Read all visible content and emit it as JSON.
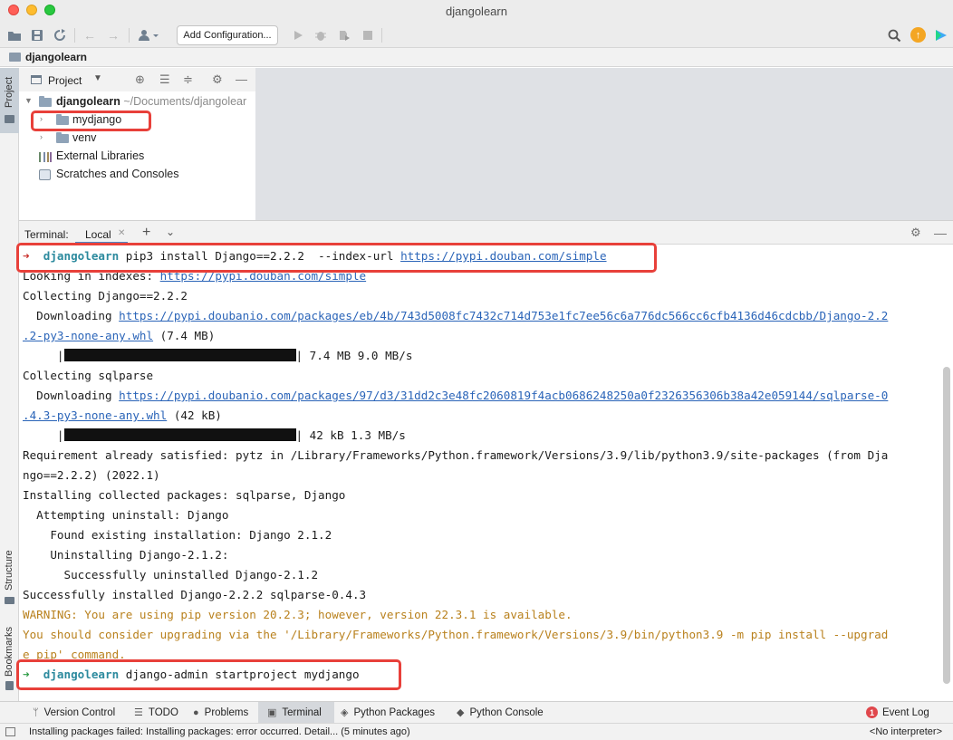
{
  "window": {
    "title": "djangolearn"
  },
  "toolbar": {
    "add_configuration": "Add Configuration...",
    "update_badge": "↑"
  },
  "navbar": {
    "project": "djangolearn"
  },
  "left_strip": {
    "project": "Project",
    "structure": "Structure",
    "bookmarks": "Bookmarks"
  },
  "project_panel": {
    "header": "Project",
    "root_name": "djangolearn",
    "root_path": "~/Documents/djangolear",
    "folders": [
      "mydjango",
      "venv"
    ],
    "external_libraries": "External Libraries",
    "scratches": "Scratches and Consoles"
  },
  "terminal": {
    "title": "Terminal:",
    "tab": "Local",
    "lines": {
      "l1_cmd": "pip3 install Django==2.2.2  --index-url ",
      "l1_url": "https://pypi.douban.com/simple",
      "l2_pre": "Looking in indexes: ",
      "l2_url": "https://pypi.douban.com/simple",
      "l3": "Collecting Django==2.2.2",
      "l4_pre": "  Downloading ",
      "l4_url": "https://pypi.doubanio.com/packages/eb/4b/743d5008fc7432c714d753e1fc7ee56c6a776dc566cc6cfb4136d46cdcbb/Django-2.2",
      "l5_url": ".2-py3-none-any.whl",
      "l5_post": " (7.4 MB)",
      "l6_pre": "     |",
      "l6_post": "| 7.4 MB 9.0 MB/s",
      "l7": "Collecting sqlparse",
      "l8_pre": "  Downloading ",
      "l8_url": "https://pypi.doubanio.com/packages/97/d3/31dd2c3e48fc2060819f4acb0686248250a0f2326356306b38a42e059144/sqlparse-0",
      "l9_url": ".4.3-py3-none-any.whl",
      "l9_post": " (42 kB)",
      "l10_pre": "     |",
      "l10_post": "| 42 kB 1.3 MB/s",
      "l11": "Requirement already satisfied: pytz in /Library/Frameworks/Python.framework/Versions/3.9/lib/python3.9/site-packages (from Dja",
      "l12": "ngo==2.2.2) (2022.1)",
      "l13": "Installing collected packages: sqlparse, Django",
      "l14": "  Attempting uninstall: Django",
      "l15": "    Found existing installation: Django 2.1.2",
      "l16": "    Uninstalling Django-2.1.2:",
      "l17": "      Successfully uninstalled Django-2.1.2",
      "l18": "Successfully installed Django-2.2.2 sqlparse-0.4.3",
      "l19": "WARNING: You are using pip version 20.2.3; however, version 22.3.1 is available.",
      "l20": "You should consider upgrading via the '/Library/Frameworks/Python.framework/Versions/3.9/bin/python3.9 -m pip install --upgrad",
      "l21": "e pip' command.",
      "l22_cmd": "django-admin startproject mydjango"
    },
    "prompt_dir": "djangolearn",
    "prompt_arrow": "➜"
  },
  "bottom_tabs": {
    "version_control": "Version Control",
    "todo": "TODO",
    "problems": "Problems",
    "terminal": "Terminal",
    "python_packages": "Python Packages",
    "python_console": "Python Console",
    "event_log": "Event Log",
    "event_count": "1"
  },
  "status": {
    "message": "Installing packages failed: Installing packages: error occurred. Detail... (5 minutes ago)",
    "interpreter": "<No interpreter>"
  }
}
